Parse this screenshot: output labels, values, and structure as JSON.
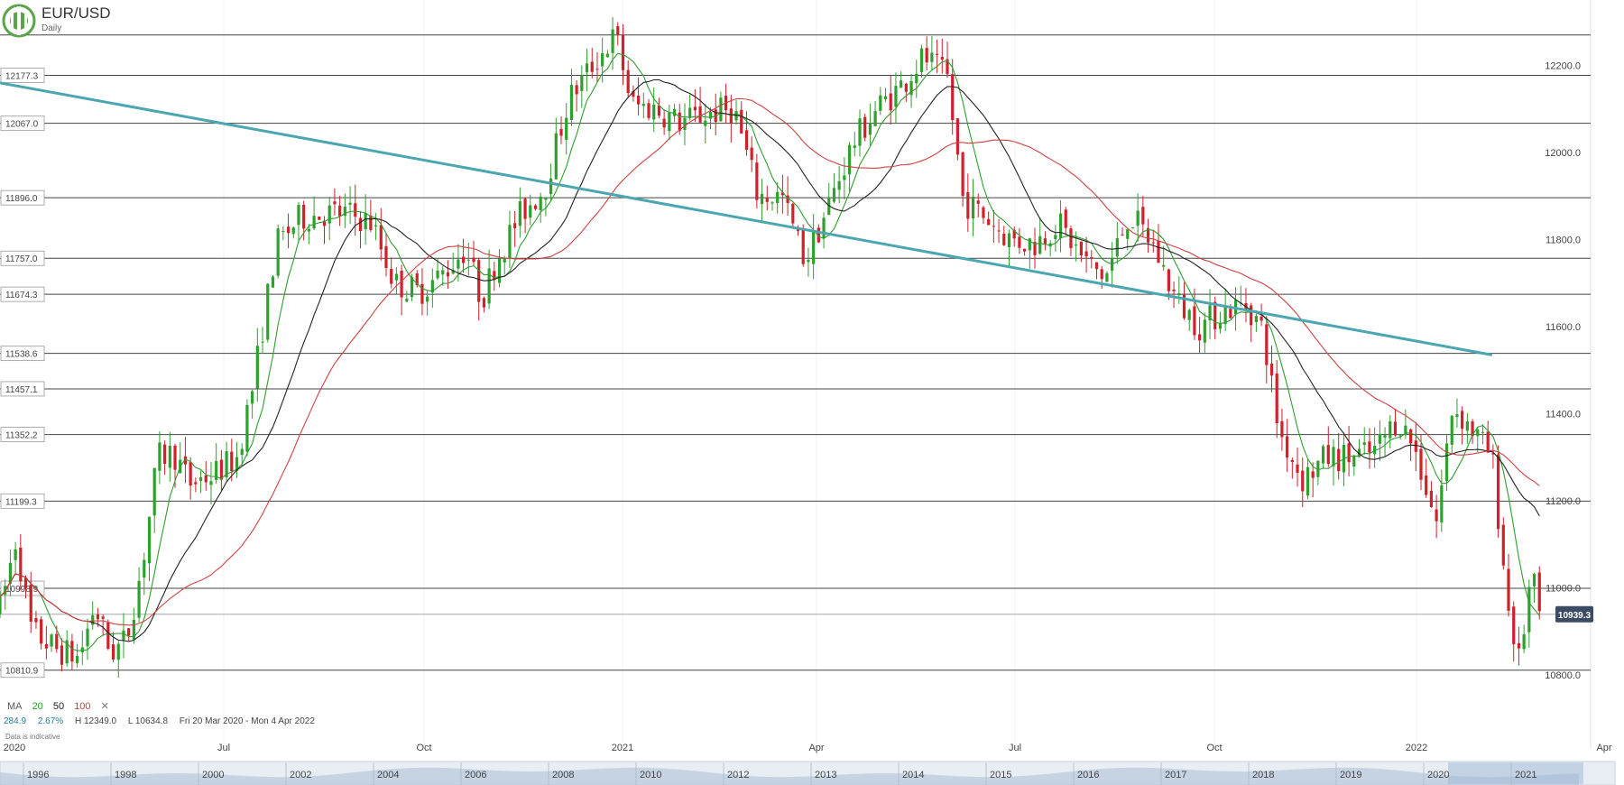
{
  "header": {
    "title": "EUR/USD",
    "subtitle": "Daily"
  },
  "indicators": {
    "ma_label": "MA",
    "periods": [
      "20",
      "50",
      "100"
    ],
    "close_symbol": "✕",
    "colors": {
      "ma20": "#2e9e2e",
      "ma50": "#222222",
      "ma100": "#d04040"
    }
  },
  "stats": {
    "change": "284.9",
    "change_pct": "2.67%",
    "high": "H 12349.0",
    "low": "L 10634.8",
    "range": "Fri 20 Mar 2020 - Mon 4 Apr 2022"
  },
  "footer_note": "Data is indicative",
  "colors": {
    "up": "#2ea02e",
    "down": "#d0202a",
    "trendline": "#4aa6b0",
    "current_price_bg": "#3b4b63"
  },
  "chart_data": {
    "type": "candlestick",
    "title": "EUR/USD",
    "subtitle": "Daily",
    "ylim": [
      10760,
      12380
    ],
    "y_ticks": [
      10800,
      11000,
      11200,
      11400,
      11600,
      11800,
      12000,
      12200
    ],
    "y_tick_labels": [
      "10800.0",
      "11000.0",
      "11200.0",
      "11400.0",
      "11600.0",
      "11800.0",
      "12000.0",
      "12200.0"
    ],
    "x_ticks": [
      "2020",
      "Jul",
      "Oct",
      "2021",
      "Apr",
      "Jul",
      "Oct",
      "2022",
      "Apr"
    ],
    "current_price": 10939.3,
    "current_price_label": "10939.3",
    "horizontal_levels": [
      12270,
      12177.3,
      12067.0,
      11896.0,
      11757.0,
      11674.3,
      11538.6,
      11457.1,
      11352.2,
      11199.3,
      10998.9,
      10810.9
    ],
    "level_labels": [
      "12177.3",
      "12067.0",
      "11896.0",
      "11757.0",
      "11674.3",
      "11538.6",
      "11457.1",
      "11352.2",
      "11199.3",
      "10998.9",
      "10810.9"
    ],
    "trendline": {
      "x": [
        0,
        0.945
      ],
      "y": [
        12160,
        11535
      ]
    },
    "price_path": [
      [
        0.0,
        10950
      ],
      [
        0.01,
        11110
      ],
      [
        0.02,
        10900
      ],
      [
        0.035,
        10860
      ],
      [
        0.05,
        10840
      ],
      [
        0.06,
        10960
      ],
      [
        0.07,
        10850
      ],
      [
        0.08,
        10880
      ],
      [
        0.09,
        11050
      ],
      [
        0.1,
        11300
      ],
      [
        0.11,
        11310
      ],
      [
        0.12,
        11240
      ],
      [
        0.135,
        11260
      ],
      [
        0.15,
        11300
      ],
      [
        0.16,
        11460
      ],
      [
        0.175,
        11790
      ],
      [
        0.19,
        11850
      ],
      [
        0.205,
        11860
      ],
      [
        0.22,
        11860
      ],
      [
        0.235,
        11840
      ],
      [
        0.25,
        11700
      ],
      [
        0.265,
        11680
      ],
      [
        0.28,
        11720
      ],
      [
        0.295,
        11780
      ],
      [
        0.305,
        11660
      ],
      [
        0.315,
        11760
      ],
      [
        0.33,
        11860
      ],
      [
        0.345,
        11920
      ],
      [
        0.36,
        12120
      ],
      [
        0.375,
        12200
      ],
      [
        0.39,
        12270
      ],
      [
        0.4,
        12110
      ],
      [
        0.415,
        12100
      ],
      [
        0.43,
        12070
      ],
      [
        0.45,
        12090
      ],
      [
        0.465,
        12100
      ],
      [
        0.48,
        11900
      ],
      [
        0.495,
        11900
      ],
      [
        0.51,
        11750
      ],
      [
        0.525,
        11880
      ],
      [
        0.54,
        12020
      ],
      [
        0.555,
        12100
      ],
      [
        0.57,
        12150
      ],
      [
        0.585,
        12220
      ],
      [
        0.6,
        12170
      ],
      [
        0.61,
        11890
      ],
      [
        0.625,
        11850
      ],
      [
        0.64,
        11800
      ],
      [
        0.655,
        11790
      ],
      [
        0.67,
        11840
      ],
      [
        0.685,
        11760
      ],
      [
        0.7,
        11710
      ],
      [
        0.715,
        11860
      ],
      [
        0.73,
        11790
      ],
      [
        0.745,
        11660
      ],
      [
        0.76,
        11600
      ],
      [
        0.775,
        11640
      ],
      [
        0.79,
        11650
      ],
      [
        0.8,
        11590
      ],
      [
        0.81,
        11360
      ],
      [
        0.825,
        11250
      ],
      [
        0.84,
        11300
      ],
      [
        0.855,
        11300
      ],
      [
        0.87,
        11310
      ],
      [
        0.885,
        11390
      ],
      [
        0.895,
        11330
      ],
      [
        0.91,
        11150
      ],
      [
        0.92,
        11420
      ],
      [
        0.935,
        11350
      ],
      [
        0.945,
        11300
      ],
      [
        0.955,
        10960
      ],
      [
        0.962,
        10830
      ],
      [
        0.97,
        11030
      ],
      [
        0.975,
        10939
      ]
    ]
  },
  "navigator": {
    "years": [
      "1996",
      "1998",
      "2000",
      "2002",
      "2004",
      "2006",
      "2008",
      "2010",
      "2012",
      "2013",
      "2014",
      "2015",
      "2016",
      "2017",
      "2018",
      "2019",
      "2020",
      "2021"
    ]
  }
}
